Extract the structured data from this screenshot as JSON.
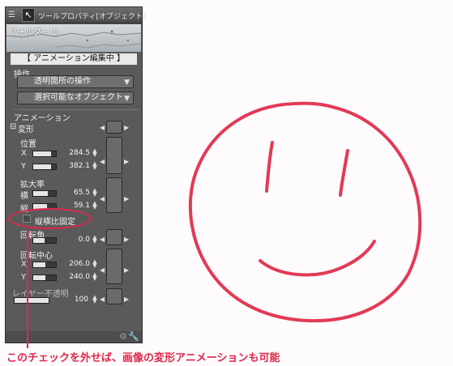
{
  "panel": {
    "title": "ツールプロパティ[オブジェクト]",
    "folder_name": "フォルダー 1",
    "animation_edit_label": "【 アニメーション編集中 】",
    "operation": {
      "section_label": "操作",
      "transparent_dropdown": "透明箇所の操作",
      "selectable_dropdown": "選択可能なオブジェクト"
    },
    "animation": {
      "section_label": "アニメーション",
      "transform_label": "変形",
      "position_label": "位置",
      "x_label": "X",
      "x_value": "284.5",
      "y_label": "Y",
      "y_value": "382.1",
      "scale_label": "拡大率",
      "scale_h_label": "横",
      "scale_h_value": "65.5",
      "scale_v_label": "縦",
      "scale_v_value": "59.1",
      "keep_ratio_label": "縦横比固定",
      "rotation_label": "回転角",
      "rotation_value": "0.0",
      "center_label": "回転中心",
      "center_x_label": "X",
      "center_x_value": "206.0",
      "center_y_label": "Y",
      "center_y_value": "240.0",
      "opacity_label": "レイヤー不透明",
      "opacity_value": "100"
    }
  },
  "caption": "このチェックを外せば、画像の変形アニメーションも可能",
  "colors": {
    "accent": "#e0284a",
    "panel_bg": "#5a5a5a",
    "canvas_bg": "#fdfbfb"
  }
}
